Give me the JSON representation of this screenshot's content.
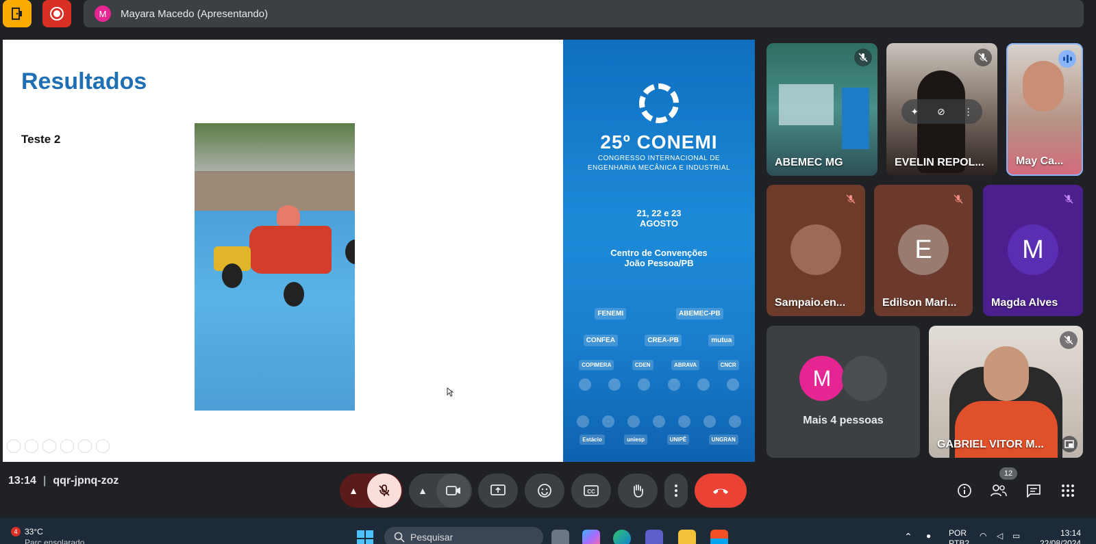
{
  "top": {
    "presenter_initial": "M",
    "presenter_label": "Mayara Macedo (Apresentando)"
  },
  "slide": {
    "title": "Resultados",
    "subtitle": "Teste 2",
    "banner": {
      "title": "25º CONEMI",
      "subtitle_line1": "CONGRESSO INTERNACIONAL DE",
      "subtitle_line2": "ENGENHARIA MECÂNICA E INDUSTRIAL",
      "date_line1": "21, 22 e 23",
      "date_line2": "AGOSTO",
      "place_line1": "Centro de Convenções",
      "place_line2": "João Pessoa/PB",
      "realizacao_logo": "FENEMI",
      "correalizacao_logo": "ABEMEC-PB",
      "sponsors": [
        "CONFEA",
        "CREA-PB",
        "mutua"
      ],
      "support": [
        "COPIMERA",
        "CDEN",
        "ABRAVA",
        "CNCR"
      ],
      "universities": [
        "Estácio",
        "uniesp",
        "UNIPÊ",
        "UNGRAN"
      ]
    }
  },
  "participants": [
    {
      "name": "ABEMEC MG"
    },
    {
      "name": "EVELIN REPOL..."
    },
    {
      "name": "May Ca..."
    },
    {
      "name": "Sampaio.en..."
    },
    {
      "name": "Edilson Mari...",
      "initial": "E"
    },
    {
      "name": "Magda Alves",
      "initial": "M"
    },
    {
      "name": "Mais 4 pessoas",
      "initial": "M"
    },
    {
      "name": "GABRIEL VITOR M..."
    }
  ],
  "bottom": {
    "time": "13:14",
    "meeting_code": "qqr-jpnq-zoz",
    "people_count": "12"
  },
  "taskbar": {
    "weather_badge": "4",
    "temperature": "33°C",
    "weather_desc": "Parc ensolarado",
    "search_placeholder": "Pesquisar",
    "lang_line1": "POR",
    "lang_line2": "PTB2",
    "clock_time": "13:14",
    "clock_date": "22/08/2024"
  },
  "colors": {
    "meet_bg": "#202124",
    "control_bg": "#3c4043",
    "end_call": "#ea4335",
    "title_blue": "#1f6fb4"
  }
}
